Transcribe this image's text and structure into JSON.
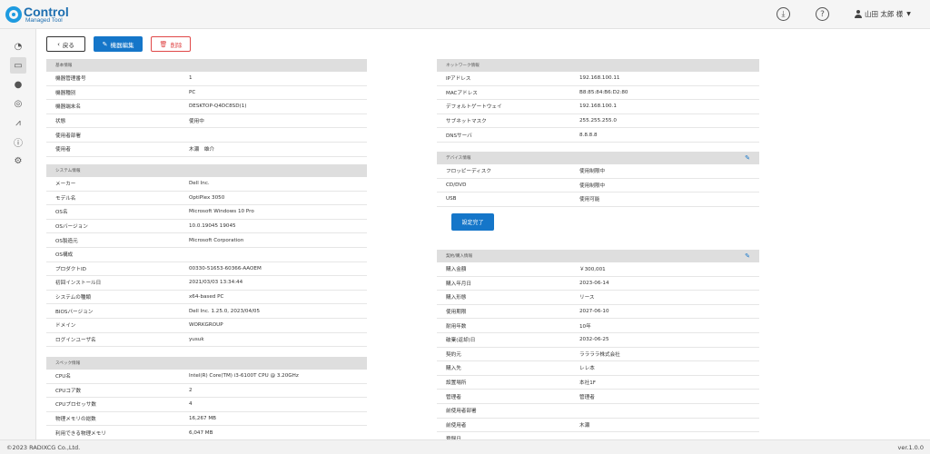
{
  "header": {
    "logo_main": "Control",
    "logo_sub": "Managed Tool",
    "download_icon": "download-icon",
    "help_icon": "help-icon",
    "user_name": "山田 太郎 様"
  },
  "sidebar": {
    "items": [
      {
        "icon": "dashboard-icon",
        "glyph": "◔"
      },
      {
        "icon": "computer-icon",
        "glyph": "▭"
      },
      {
        "icon": "disc-icon",
        "glyph": "●"
      },
      {
        "icon": "location-icon",
        "glyph": "◎"
      },
      {
        "icon": "chart-icon",
        "glyph": "⩘"
      },
      {
        "icon": "alert-icon",
        "glyph": "ⓘ"
      },
      {
        "icon": "user-settings-icon",
        "glyph": "⚙"
      }
    ]
  },
  "toolbar": {
    "back_label": "戻る",
    "edit_label": "機器編集",
    "delete_label": "削除"
  },
  "basic": {
    "title": "基本情報",
    "rows": [
      {
        "k": "機器管理番号",
        "v": "1"
      },
      {
        "k": "機器種別",
        "v": "PC"
      },
      {
        "k": "機器端末名",
        "v": "DESKTOP-Q4DC8SD(1)"
      },
      {
        "k": "状態",
        "v": "使用中"
      },
      {
        "k": "使用者部署",
        "v": ""
      },
      {
        "k": "使用者",
        "v": "木瀬　雄介"
      }
    ]
  },
  "system": {
    "title": "システム情報",
    "rows": [
      {
        "k": "メーカー",
        "v": "Dell Inc."
      },
      {
        "k": "モデル名",
        "v": "OptiPlex 3050"
      },
      {
        "k": "OS名",
        "v": "Microsoft Windows 10 Pro"
      },
      {
        "k": "OSバージョン",
        "v": "10.0.19045 19045"
      },
      {
        "k": "OS製造元",
        "v": "Microsoft Corporation"
      },
      {
        "k": "OS構成",
        "v": ""
      },
      {
        "k": "プロダクトID",
        "v": "00330-51653-60366-AAOEM"
      },
      {
        "k": "初回インストール日",
        "v": "2021/03/03 13:34:44"
      },
      {
        "k": "システムの種類",
        "v": "x64-based PC"
      },
      {
        "k": "BIOSバージョン",
        "v": "Dell Inc. 1.25.0, 2023/04/05"
      },
      {
        "k": "ドメイン",
        "v": "WORKGROUP"
      },
      {
        "k": "ログインユーザ名",
        "v": "yusuk"
      }
    ]
  },
  "spec": {
    "title": "スペック情報",
    "rows": [
      {
        "k": "CPU名",
        "v": "Intel(R) Core(TM) i3-6100T CPU @ 3.20GHz"
      },
      {
        "k": "CPUコア数",
        "v": "2"
      },
      {
        "k": "CPUプロセッサ数",
        "v": "4"
      },
      {
        "k": "物理メモリの総数",
        "v": "16,267 MB"
      },
      {
        "k": "利用できる物理メモリ",
        "v": "6,047 MB"
      }
    ]
  },
  "network": {
    "title": "ネットワーク情報",
    "rows": [
      {
        "k": "IPアドレス",
        "v": "192.168.100.11"
      },
      {
        "k": "MACアドレス",
        "v": "B8:85:84:B6:D2:80"
      },
      {
        "k": "デフォルトゲートウェイ",
        "v": "192.168.100.1"
      },
      {
        "k": "サブネットマスク",
        "v": "255.255.255.0"
      },
      {
        "k": "DNSサーバ",
        "v": "8.8.8.8"
      }
    ]
  },
  "device": {
    "title": "デバイス情報",
    "rows": [
      {
        "k": "フロッピーディスク",
        "v": "使用制限中"
      },
      {
        "k": "CD/DVD",
        "v": "使用制限中"
      },
      {
        "k": "USB",
        "v": "使用可能"
      }
    ],
    "done_label": "設定完了"
  },
  "contract": {
    "title": "契約/購入情報",
    "rows": [
      {
        "k": "購入金額",
        "v": "￥300,001"
      },
      {
        "k": "購入年月日",
        "v": "2023-06-14"
      },
      {
        "k": "購入形態",
        "v": "リース"
      },
      {
        "k": "使用期限",
        "v": "2027-06-10"
      },
      {
        "k": "耐用年数",
        "v": "10年"
      },
      {
        "k": "破棄(返却)日",
        "v": "2032-06-25"
      },
      {
        "k": "契約元",
        "v": "ララララ株式会社"
      },
      {
        "k": "購入先",
        "v": "レレ本"
      },
      {
        "k": "設置場所",
        "v": "本社1F"
      },
      {
        "k": "管理者",
        "v": "管理者"
      },
      {
        "k": "前使用者部署",
        "v": ""
      },
      {
        "k": "前使用者",
        "v": "木瀬"
      },
      {
        "k": "登録日",
        "v": ""
      }
    ]
  },
  "footer": {
    "copyright": "©2023 RADIXCG Co.,Ltd.",
    "version": "ver.1.0.0"
  },
  "colors": {
    "primary": "#1576c9",
    "danger": "#e04848",
    "header_bg": "#dedede"
  }
}
